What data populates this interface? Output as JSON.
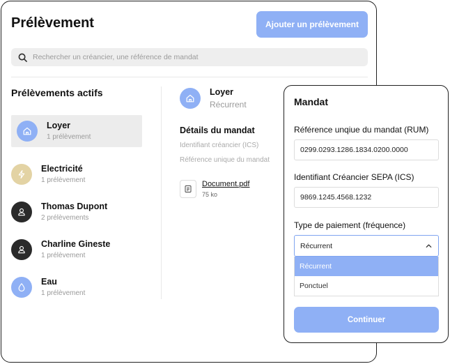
{
  "header": {
    "title": "Prélèvement",
    "add_button": "Ajouter un prélèvement"
  },
  "search": {
    "placeholder": "Rechercher un créancier, une référence de mandat"
  },
  "sidebar": {
    "title": "Prélèvements actifs",
    "items": [
      {
        "name": "Loyer",
        "sub": "1 prélèvement",
        "icon": "home-icon",
        "color": "#8fb0f5",
        "active": true
      },
      {
        "name": "Electricité",
        "sub": "1 prélèvement",
        "icon": "lightning-icon",
        "color": "#e3d3a4",
        "active": false
      },
      {
        "name": "Thomas Dupont",
        "sub": "2 prélèvements",
        "icon": "user-icon",
        "color": "#2a2a2a",
        "active": false
      },
      {
        "name": "Charline Gineste",
        "sub": "1 prélèvement",
        "icon": "user-icon",
        "color": "#2a2a2a",
        "active": false
      },
      {
        "name": "Eau",
        "sub": "1 prélèvement",
        "icon": "water-drop-icon",
        "color": "#8fb0f5",
        "active": false
      }
    ]
  },
  "detail": {
    "name": "Loyer",
    "type": "Récurrent",
    "section_title": "Détails du mandat",
    "field_1": "Identifiant créancier (ICS)",
    "field_2": "Référence unique du mandat",
    "document_name": "Document.pdf",
    "document_size": "75 ko"
  },
  "modal": {
    "title": "Mandat",
    "rum_label": "Référence unqiue du mandat (RUM)",
    "rum_value": "0299.0293.1286.1834.0200.0000",
    "ics_label": "Identifiant Créancier SEPA (ICS)",
    "ics_value": "9869.1245.4568.1232",
    "payment_label": "Type de paiement (fréquence)",
    "payment_selected": "Récurrent",
    "options": [
      "Récurrent",
      "Ponctuel"
    ],
    "continue_label": "Continuer"
  },
  "colors": {
    "accent": "#8fb0f5",
    "electricity": "#e3d3a4",
    "dark": "#2a2a2a"
  }
}
